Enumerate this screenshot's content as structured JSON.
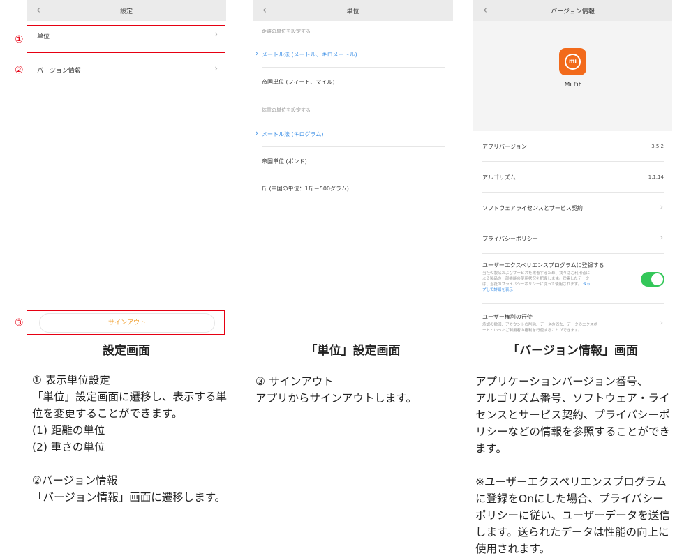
{
  "screen1": {
    "nav_title": "設定",
    "back_icon": "chevron-left",
    "rows": [
      {
        "label": "単位",
        "icon": "chevron-right"
      },
      {
        "label": "バージョン情報",
        "icon": "chevron-right"
      }
    ],
    "signout_label": "サインアウト",
    "markers": [
      "①",
      "②",
      "③"
    ],
    "caption": "設定画面"
  },
  "screen2": {
    "nav_title": "単位",
    "distance_header": "距離の単位を設定する",
    "distance_options": [
      {
        "label": "メートル法 (メートル、キロメートル)",
        "selected": true
      },
      {
        "label": "帝国単位 (フィート、マイル)",
        "selected": false
      }
    ],
    "weight_header": "体重の単位を設定する",
    "weight_options": [
      {
        "label": "メートル法 (キログラム)",
        "selected": true
      },
      {
        "label": "帝国単位 (ポンド)",
        "selected": false
      },
      {
        "label": "斤 (中国の単位：1斤＝500グラム)",
        "selected": false
      }
    ],
    "caption": "「単位」設定画面"
  },
  "screen3": {
    "nav_title": "バージョン情報",
    "app_icon_text": "mi",
    "app_name": "Mi Fit",
    "items": [
      {
        "label": "アプリバージョン",
        "value": "3.5.2"
      },
      {
        "label": "アルゴリズム",
        "value": "1.1.14"
      },
      {
        "label": "ソフトウェアライセンスとサービス契約",
        "icon": "chevron-right"
      },
      {
        "label": "プライバシーポリシー",
        "icon": "chevron-right"
      }
    ],
    "ux_program": {
      "label": "ユーザーエクスペリエンスプログラムに登録する",
      "desc_lines": [
        "当社の製品およびサービスを改善するため、我々はご利用者に",
        "よる製品の一部機能の使用状況を把握します。収集したデータ",
        "は、当社のプライバシーポリシーに従って使用されます。"
      ],
      "link_a": "タッ",
      "link_b": "プして詳細を表示",
      "toggle_on": true,
      "toggle_color": "#34c759"
    },
    "user_rights": {
      "label": "ユーザー権利の行使",
      "desc_lines": [
        "承認の撤回、アカウントの削除、データの消去、データのエクスポ",
        "ートといったご利用者の権利を行使することができます。"
      ],
      "icon": "chevron-right"
    },
    "caption": "「バージョン情報」画面"
  },
  "explanations": {
    "col1": {
      "lines": [
        "① 表示単位設定",
        "「単位」設定画面に遷移し、表示する単",
        "位を変更することができます。",
        "(1) 距離の単位",
        "(2) 重さの単位",
        "",
        "②バージョン情報",
        "「バージョン情報」画面に遷移します。"
      ]
    },
    "col2": {
      "lines": [
        "③ サインアウト",
        "アプリからサインアウトします。"
      ]
    },
    "col3": {
      "lines": [
        "アプリケーションバージョン番号、",
        "アルゴリズム番号、ソフトウェア・ライ",
        "センスとサービス契約、プライバシーポ",
        "リシーなどの情報を参照することができ",
        "ます。",
        "",
        "※ユーザーエクスペリエンスプログラム",
        "に登録をOnにした場合、プライバシー",
        "ポリシーに従い、ユーザーデータを送信",
        "します。送られたデータは性能の向上に",
        "使用されます。"
      ]
    }
  },
  "colors": {
    "marker_red": "#e60012",
    "selected_blue": "#3a8ee6",
    "signout_orange": "#f0a030",
    "app_icon_orange": "#f26a1b"
  }
}
